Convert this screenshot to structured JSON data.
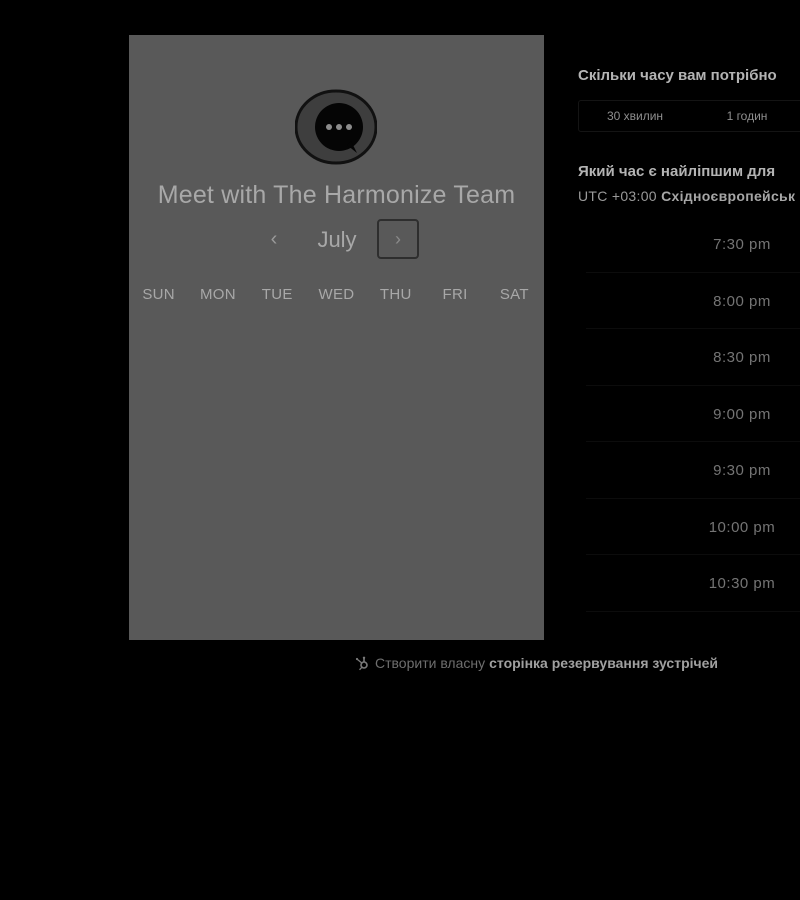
{
  "card": {
    "logo_icon": "chat-bubble-ellipsis-icon",
    "title": "Meet with The Harmonize Team",
    "month": "July",
    "prev_icon": "‹",
    "next_icon": "›",
    "weekdays": [
      "SUN",
      "MON",
      "TUE",
      "WED",
      "THU",
      "FRI",
      "SAT"
    ]
  },
  "right": {
    "duration_question": "Скільки часу вам потрібно",
    "duration_options": [
      "30 хвилин",
      "1 годин"
    ],
    "time_question": "Який час є найліпшим для",
    "timezone_offset": "UTC +03:00",
    "timezone_name": "Східноєвропейськ",
    "slots": [
      "7:30 pm",
      "8:00 pm",
      "8:30 pm",
      "9:00 pm",
      "9:30 pm",
      "10:00 pm",
      "10:30 pm"
    ]
  },
  "footer": {
    "icon": "hubspot-sprocket-icon",
    "prefix": "Створити власну",
    "link": "сторінка резервування зустрічей"
  }
}
